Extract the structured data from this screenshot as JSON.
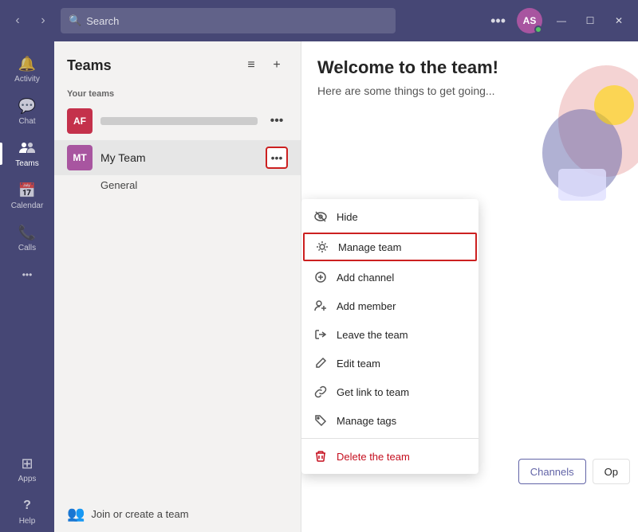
{
  "titlebar": {
    "nav_back": "‹",
    "nav_forward": "›",
    "search_placeholder": "Search",
    "ellipsis": "•••",
    "avatar_initials": "AS",
    "win_minimize": "—",
    "win_maximize": "☐",
    "win_close": "✕"
  },
  "sidebar": {
    "items": [
      {
        "id": "activity",
        "label": "Activity",
        "icon": "🔔"
      },
      {
        "id": "chat",
        "label": "Chat",
        "icon": "💬"
      },
      {
        "id": "teams",
        "label": "Teams",
        "icon": "👥"
      },
      {
        "id": "calendar",
        "label": "Calendar",
        "icon": "📅"
      },
      {
        "id": "calls",
        "label": "Calls",
        "icon": "📞"
      },
      {
        "id": "more",
        "label": "•••",
        "icon": "•••"
      }
    ],
    "bottom_items": [
      {
        "id": "apps",
        "label": "Apps",
        "icon": "⊞"
      },
      {
        "id": "help",
        "label": "Help",
        "icon": "?"
      }
    ]
  },
  "teams_panel": {
    "title": "Teams",
    "your_teams_label": "Your teams",
    "team1_initials": "AF",
    "team2_initials": "MT",
    "team2_name": "My Team",
    "channel_name": "General",
    "join_label": "Join or create a team",
    "filter_icon": "≡",
    "add_icon": "+"
  },
  "context_menu": {
    "items": [
      {
        "id": "hide",
        "label": "Hide",
        "icon": "👁"
      },
      {
        "id": "manage-team",
        "label": "Manage team",
        "icon": "⚙",
        "highlighted": true
      },
      {
        "id": "add-channel",
        "label": "Add channel",
        "icon": "⊕"
      },
      {
        "id": "add-member",
        "label": "Add member",
        "icon": "👤+"
      },
      {
        "id": "leave-team",
        "label": "Leave the team",
        "icon": "🚪"
      },
      {
        "id": "edit-team",
        "label": "Edit team",
        "icon": "✏"
      },
      {
        "id": "get-link",
        "label": "Get link to team",
        "icon": "🔗"
      },
      {
        "id": "manage-tags",
        "label": "Manage tags",
        "icon": "🏷"
      },
      {
        "id": "delete-team",
        "label": "Delete the team",
        "icon": "🗑",
        "delete": true
      }
    ]
  },
  "main": {
    "title": "Welcome to the team!",
    "subtitle": "Here are some things to get going...",
    "channels_button": "Channels",
    "open_button": "Op"
  }
}
